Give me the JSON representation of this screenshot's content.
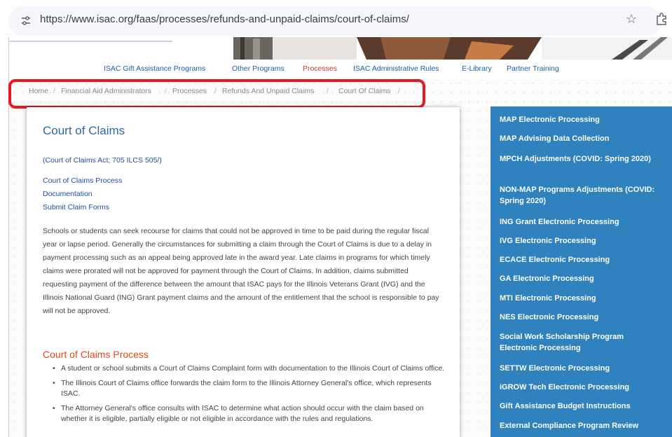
{
  "browser": {
    "url": "https://www.isac.org/faas/processes/refunds-and-unpaid-claims/court-of-claims/",
    "icons": {
      "site_info": "tune-icon",
      "bookmark": "star-icon",
      "extensions": "puzzle-icon"
    }
  },
  "nav": {
    "items": [
      {
        "label": "ISAC Gift Assistance Programs"
      },
      {
        "label": "Other Programs"
      },
      {
        "label": "Processes",
        "active": true
      },
      {
        "label": "ISAC Administrative Rules"
      },
      {
        "label": "E-Library"
      },
      {
        "label": "Partner Training"
      }
    ]
  },
  "breadcrumb": {
    "items": [
      "Home",
      "Financial Aid Administrators",
      "Processes",
      "Refunds And Unpaid Claims",
      "Court Of Claims"
    ]
  },
  "content": {
    "title": "Court of Claims",
    "act_reference": "(Court of Claims Act; 705 ILCS 505/)",
    "links": [
      "Court of Claims Process",
      "Documentation",
      "Submit Claim Forms"
    ],
    "paragraph": "Schools or students can seek recourse for claims that could not be approved in time to be paid during the regular fiscal year or lapse period. Generally the circumstances for submitting a claim through the Court of Claims is due to a delay in payment processing such as an appeal being approved late in the award year. Late claims in programs for which timely claims were prorated will not be approved for payment through the Court of Claims. In addition, claims submitted requesting payment of the difference between the amount that ISAC pays for the Illinois Veterans Grant (IVG) and the Illinois National Guard (ING) Grant payment claims and the amount of the entitlement that the school is responsible to pay will not be approved.",
    "section_title": "Court of Claims Process",
    "bullets": [
      "A student or school submits a Court of Claims Complaint form with documentation to the Illinois Court of Claims office.",
      "The Illinois Court of Claims office forwards the claim form to the Illinois Attorney General's office, which represents ISAC.",
      "The Attorney General's office consults with ISAC to determine what action should occur with the claim based on whether it is eligible, partially eligible or not eligible in accordance with the rules and regulations."
    ]
  },
  "sidebar": {
    "items": [
      "MAP Electronic Processing",
      "MAP Advising Data Collection",
      "MPCH Adjustments (COVID: Spring 2020)",
      "NON-MAP Programs Adjustments (COVID: Spring 2020)",
      "ING Grant Electronic Processing",
      "IVG Electronic Processing",
      "ECACE Electronic Processing",
      "GA Electronic Processing",
      "MTI Electronic Processing",
      "NES Electronic Processing",
      "Social Work Scholarship Program Electronic Processing",
      "SETTW Electronic Processing",
      "iGROW Tech Electronic Processing",
      "Gift Assistance Budget Instructions",
      "External Compliance Program Review"
    ]
  },
  "colors": {
    "highlight": "#e8191d",
    "sidebar_bg": "#2f82bd",
    "nav_active": "#c0392b",
    "section_heading": "#e04a1a",
    "title": "#2d6aa3"
  }
}
